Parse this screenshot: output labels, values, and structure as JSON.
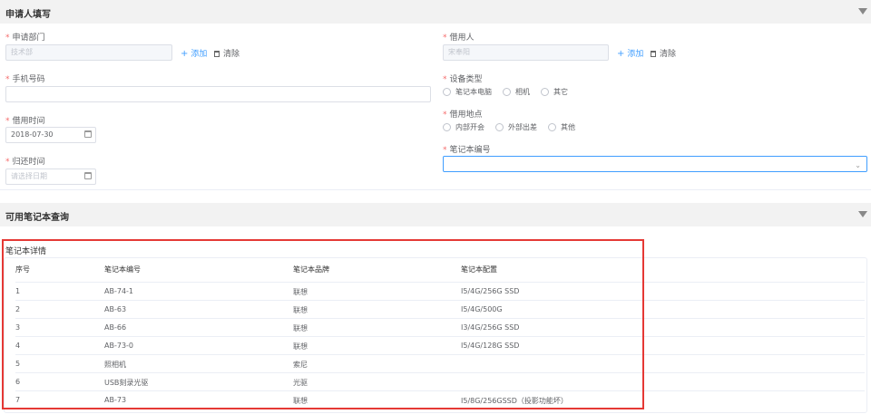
{
  "section1": {
    "title": "申请人填写"
  },
  "section2": {
    "title": "可用笔记本查询"
  },
  "form": {
    "dept_label": "申请部门",
    "dept_value": "技术部",
    "borrower_label": "借用人",
    "borrower_value": "宋奉阳",
    "add_label": "添加",
    "clear_label": "清除",
    "phone_label": "手机号码",
    "phone_value": "",
    "device_type_label": "设备类型",
    "device_types": [
      "笔记本电脑",
      "相机",
      "其它"
    ],
    "borrow_time_label": "借用时间",
    "borrow_time_value": "2018-07-30",
    "location_label": "借用地点",
    "locations": [
      "内部开会",
      "外部出差",
      "其他"
    ],
    "return_time_label": "归还时间",
    "return_time_placeholder": "请选择日期",
    "laptop_no_label": "笔记本编号",
    "laptop_no_value": ""
  },
  "details": {
    "label": "笔记本详情",
    "columns": [
      "序号",
      "笔记本编号",
      "笔记本品牌",
      "笔记本配置"
    ],
    "rows": [
      [
        "1",
        "AB-74-1",
        "联想",
        "I5/4G/256G SSD"
      ],
      [
        "2",
        "AB-63",
        "联想",
        "I5/4G/500G"
      ],
      [
        "3",
        "AB-66",
        "联想",
        "I3/4G/256G SSD"
      ],
      [
        "4",
        "AB-73-0",
        "联想",
        "I5/4G/128G SSD"
      ],
      [
        "5",
        "照相机",
        "索尼",
        ""
      ],
      [
        "6",
        "USB刻录光驱",
        "光驱",
        ""
      ],
      [
        "7",
        "AB-73",
        "联想",
        "I5/8G/256GSSD（投影功能坏）"
      ]
    ]
  }
}
